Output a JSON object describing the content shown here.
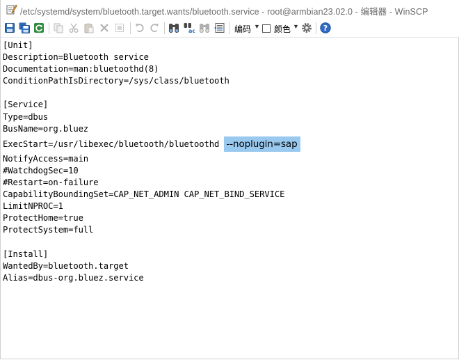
{
  "window": {
    "title": "/etc/systemd/system/bluetooth.target.wants/bluetooth.service - root@armbian23.02.0 - 编辑器 - WinSCP"
  },
  "toolbar": {
    "encoding_label": "编码",
    "color_label": "颜色",
    "icons": [
      "save-icon",
      "save-all-icon",
      "reload-icon",
      "copy-icon",
      "cut-icon",
      "paste-icon",
      "delete-icon",
      "select-all-icon",
      "undo-icon",
      "redo-icon",
      "find-icon",
      "replace-icon",
      "find-next-icon",
      "goto-line-icon",
      "encoding-dropdown",
      "color-checkbox",
      "settings-icon",
      "help-icon"
    ]
  },
  "editor": {
    "lines": [
      "[Unit]",
      "Description=Bluetooth service",
      "Documentation=man:bluetoothd(8)",
      "ConditionPathIsDirectory=/sys/class/bluetooth",
      "",
      "[Service]",
      "Type=dbus",
      "BusName=org.bluez",
      "ExecStart=/usr/libexec/bluetooth/bluetoothd ",
      "NotifyAccess=main",
      "#WatchdogSec=10",
      "#Restart=on-failure",
      "CapabilityBoundingSet=CAP_NET_ADMIN CAP_NET_BIND_SERVICE",
      "LimitNPROC=1",
      "ProtectHome=true",
      "ProtectSystem=full",
      "",
      "[Install]",
      "WantedBy=bluetooth.target",
      "Alias=dbus-org.bluez.service"
    ],
    "selected_text": "--noplugin=sap",
    "selection_color": "#99c9ef"
  }
}
